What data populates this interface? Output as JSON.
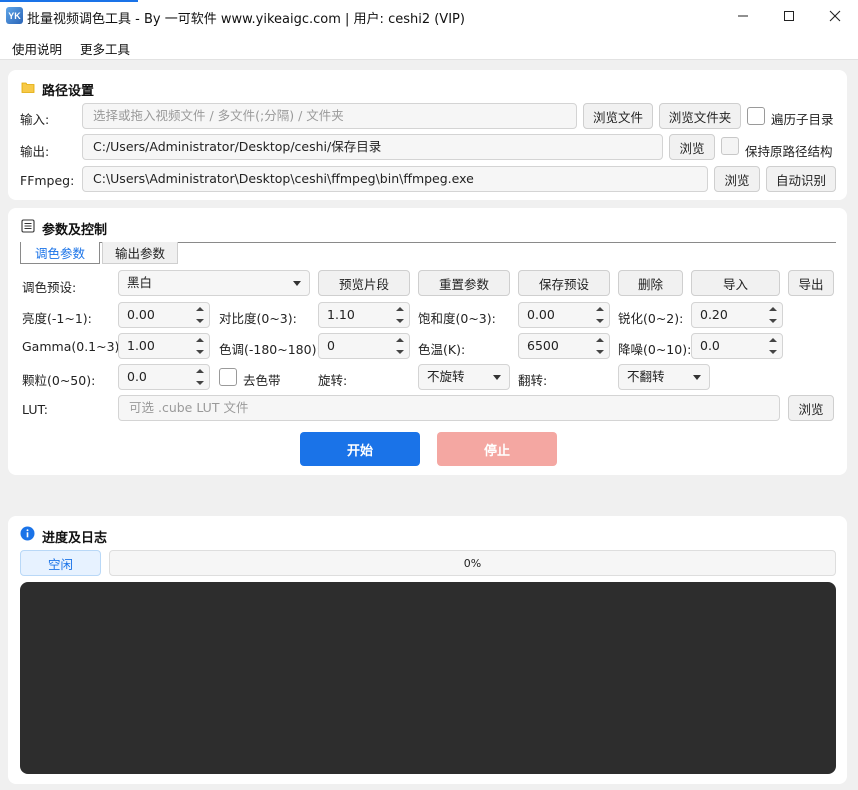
{
  "window": {
    "title": "批量视频调色工具 - By 一可软件 www.yikeaigc.com  |  用户: ceshi2 (VIP)",
    "icon_text": "YK"
  },
  "menu": [
    "使用说明",
    "更多工具"
  ],
  "path": {
    "title": "路径设置",
    "input_label": "输入:",
    "input_placeholder": "选择或拖入视频文件 / 多文件(;分隔) / 文件夹",
    "browse_file": "浏览文件",
    "browse_folder": "浏览文件夹",
    "recurse_label": "遍历子目录",
    "output_label": "输出:",
    "output_value": "C:/Users/Administrator/Desktop/ceshi/保存目录",
    "output_browse": "浏览",
    "keep_structure": "保持原路径结构",
    "ffmpeg_label": "FFmpeg:",
    "ffmpeg_value": "C:\\Users\\Administrator\\Desktop\\ceshi\\ffmpeg\\bin\\ffmpeg.exe",
    "ffmpeg_browse": "浏览",
    "auto_detect": "自动识别"
  },
  "params": {
    "title": "参数及控制",
    "tabs": [
      "调色参数",
      "输出参数"
    ],
    "preset_label": "调色预设:",
    "preset_value": "黑白",
    "preview": "预览片段",
    "reset": "重置参数",
    "save_preset": "保存预设",
    "delete": "删除",
    "import": "导入",
    "export": "导出",
    "brightness": {
      "label": "亮度(-1~1):",
      "value": "0.00"
    },
    "contrast": {
      "label": "对比度(0~3):",
      "value": "1.10"
    },
    "saturation": {
      "label": "饱和度(0~3):",
      "value": "0.00"
    },
    "sharpen": {
      "label": "锐化(0~2):",
      "value": "0.20"
    },
    "gamma": {
      "label": "Gamma(0.1~3):",
      "value": "1.00"
    },
    "hue": {
      "label": "色调(-180~180):",
      "value": "0"
    },
    "temperature": {
      "label": "色温(K):",
      "value": "6500"
    },
    "denoise": {
      "label": "降噪(0~10):",
      "value": "0.0"
    },
    "grain": {
      "label": "颗粒(0~50):",
      "value": "0.0"
    },
    "deband_label": "去色带",
    "rotate": {
      "label": "旋转:",
      "value": "不旋转"
    },
    "flip": {
      "label": "翻转:",
      "value": "不翻转"
    },
    "lut": {
      "label": "LUT:",
      "placeholder": "可选 .cube LUT 文件",
      "browse": "浏览"
    },
    "start": "开始",
    "stop": "停止"
  },
  "progress": {
    "title": "进度及日志",
    "status": "空闲",
    "percent": "0%",
    "value": 0
  },
  "colors": {
    "accent": "#1a73e8",
    "stop": "#f4a7a2",
    "log_bg": "#2d2d2d"
  }
}
